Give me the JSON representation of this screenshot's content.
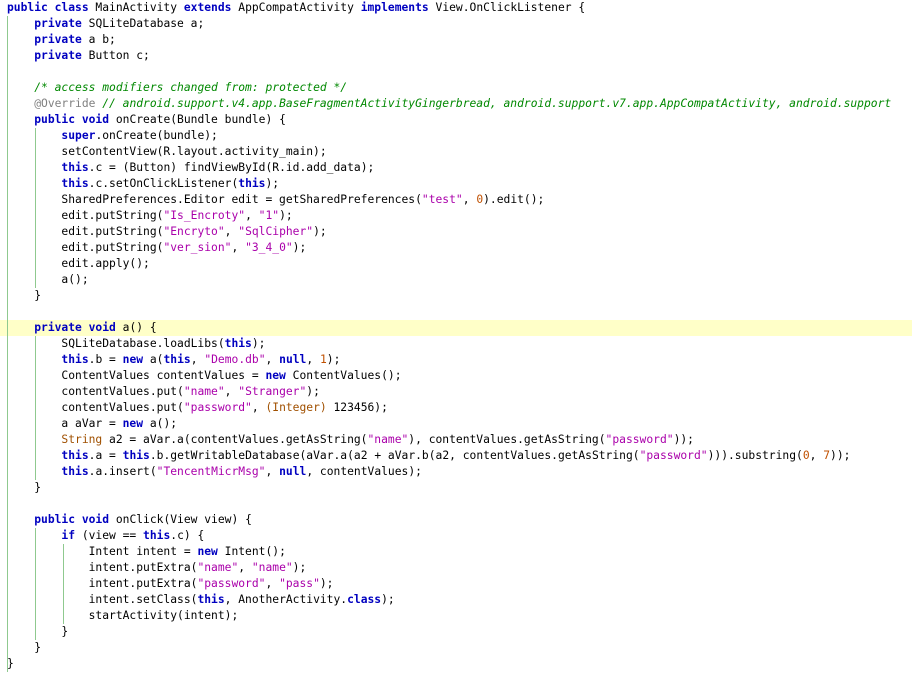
{
  "code_lines": [
    [
      [
        "kw",
        "public class "
      ],
      [
        "p",
        "MainActivity "
      ],
      [
        "kw",
        "extends "
      ],
      [
        "p",
        "AppCompatActivity "
      ],
      [
        "kw",
        "implements "
      ],
      [
        "p",
        "View.OnClickListener {"
      ]
    ],
    [
      [
        "p",
        "    "
      ],
      [
        "kw",
        "private "
      ],
      [
        "p",
        "SQLiteDatabase a;"
      ]
    ],
    [
      [
        "p",
        "    "
      ],
      [
        "kw",
        "private "
      ],
      [
        "p",
        "a b;"
      ]
    ],
    [
      [
        "p",
        "    "
      ],
      [
        "kw",
        "private "
      ],
      [
        "p",
        "Button c;"
      ]
    ],
    [],
    [
      [
        "p",
        "    "
      ],
      [
        "cm",
        "/* access modifiers changed from: protected */"
      ]
    ],
    [
      [
        "p",
        "    "
      ],
      [
        "an",
        "@Override "
      ],
      [
        "cm",
        "// android.support.v4.app.BaseFragmentActivityGingerbread, android.support.v7.app.AppCompatActivity, android.support"
      ]
    ],
    [
      [
        "p",
        "    "
      ],
      [
        "kw",
        "public void "
      ],
      [
        "p",
        "onCreate(Bundle bundle) {"
      ]
    ],
    [
      [
        "p",
        "        "
      ],
      [
        "kw",
        "super"
      ],
      [
        "p",
        ".onCreate(bundle);"
      ]
    ],
    [
      [
        "p",
        "        setContentView(R.layout.activity_main);"
      ]
    ],
    [
      [
        "p",
        "        "
      ],
      [
        "kw",
        "this"
      ],
      [
        "p",
        ".c = (Button) findViewById(R.id.add_data);"
      ]
    ],
    [
      [
        "p",
        "        "
      ],
      [
        "kw",
        "this"
      ],
      [
        "p",
        ".c.setOnClickListener("
      ],
      [
        "kw",
        "this"
      ],
      [
        "p",
        ");"
      ]
    ],
    [
      [
        "p",
        "        SharedPreferences.Editor edit = getSharedPreferences("
      ],
      [
        "str",
        "\"test\""
      ],
      [
        "p",
        ", "
      ],
      [
        "num",
        "0"
      ],
      [
        "p",
        ").edit();"
      ]
    ],
    [
      [
        "p",
        "        edit.putString("
      ],
      [
        "str",
        "\"Is_Encroty\""
      ],
      [
        "p",
        ", "
      ],
      [
        "str",
        "\"1\""
      ],
      [
        "p",
        ");"
      ]
    ],
    [
      [
        "p",
        "        edit.putString("
      ],
      [
        "str",
        "\"Encryto\""
      ],
      [
        "p",
        ", "
      ],
      [
        "str",
        "\"SqlCipher\""
      ],
      [
        "p",
        ");"
      ]
    ],
    [
      [
        "p",
        "        edit.putString("
      ],
      [
        "str",
        "\"ver_sion\""
      ],
      [
        "p",
        ", "
      ],
      [
        "str",
        "\"3_4_0\""
      ],
      [
        "p",
        ");"
      ]
    ],
    [
      [
        "p",
        "        edit.apply();"
      ]
    ],
    [
      [
        "p",
        "        a();"
      ]
    ],
    [
      [
        "p",
        "    }"
      ]
    ],
    [],
    [
      [
        "p",
        "    "
      ],
      [
        "kw",
        "private void "
      ],
      [
        "p",
        "a() {"
      ]
    ],
    [
      [
        "p",
        "        SQLiteDatabase.loadLibs("
      ],
      [
        "kw",
        "this"
      ],
      [
        "p",
        ");"
      ]
    ],
    [
      [
        "p",
        "        "
      ],
      [
        "kw",
        "this"
      ],
      [
        "p",
        ".b = "
      ],
      [
        "kw",
        "new "
      ],
      [
        "p",
        "a("
      ],
      [
        "kw",
        "this"
      ],
      [
        "p",
        ", "
      ],
      [
        "str",
        "\"Demo.db\""
      ],
      [
        "p",
        ", "
      ],
      [
        "kw",
        "null"
      ],
      [
        "p",
        ", "
      ],
      [
        "num",
        "1"
      ],
      [
        "p",
        ");"
      ]
    ],
    [
      [
        "p",
        "        ContentValues contentValues = "
      ],
      [
        "kw",
        "new "
      ],
      [
        "p",
        "ContentValues();"
      ]
    ],
    [
      [
        "p",
        "        contentValues.put("
      ],
      [
        "str",
        "\"name\""
      ],
      [
        "p",
        ", "
      ],
      [
        "str",
        "\"Stranger\""
      ],
      [
        "p",
        ");"
      ]
    ],
    [
      [
        "p",
        "        contentValues.put("
      ],
      [
        "str",
        "\"password\""
      ],
      [
        "p",
        ", "
      ],
      [
        "ty",
        "(Integer) "
      ],
      [
        "p",
        "123456);"
      ]
    ],
    [
      [
        "p",
        "        a aVar = "
      ],
      [
        "kw",
        "new "
      ],
      [
        "p",
        "a();"
      ]
    ],
    [
      [
        "p",
        "        "
      ],
      [
        "ty",
        "String "
      ],
      [
        "p",
        "a2 = aVar.a(contentValues.getAsString("
      ],
      [
        "str",
        "\"name\""
      ],
      [
        "p",
        "), contentValues.getAsString("
      ],
      [
        "str",
        "\"password\""
      ],
      [
        "p",
        "));"
      ]
    ],
    [
      [
        "p",
        "        "
      ],
      [
        "kw",
        "this"
      ],
      [
        "p",
        ".a = "
      ],
      [
        "kw",
        "this"
      ],
      [
        "p",
        ".b.getWritableDatabase(aVar.a(a2 + aVar.b(a2, contentValues.getAsString("
      ],
      [
        "str",
        "\"password\""
      ],
      [
        "p",
        "))).substring("
      ],
      [
        "num",
        "0"
      ],
      [
        "p",
        ", "
      ],
      [
        "num",
        "7"
      ],
      [
        "p",
        "));"
      ]
    ],
    [
      [
        "p",
        "        "
      ],
      [
        "kw",
        "this"
      ],
      [
        "p",
        ".a.insert("
      ],
      [
        "str",
        "\"TencentMicrMsg\""
      ],
      [
        "p",
        ", "
      ],
      [
        "kw",
        "null"
      ],
      [
        "p",
        ", contentValues);"
      ]
    ],
    [
      [
        "p",
        "    }"
      ]
    ],
    [],
    [
      [
        "p",
        "    "
      ],
      [
        "kw",
        "public void "
      ],
      [
        "p",
        "onClick(View view) {"
      ]
    ],
    [
      [
        "p",
        "        "
      ],
      [
        "kw",
        "if "
      ],
      [
        "p",
        "(view == "
      ],
      [
        "kw",
        "this"
      ],
      [
        "p",
        ".c) {"
      ]
    ],
    [
      [
        "p",
        "            Intent intent = "
      ],
      [
        "kw",
        "new "
      ],
      [
        "p",
        "Intent();"
      ]
    ],
    [
      [
        "p",
        "            intent.putExtra("
      ],
      [
        "str",
        "\"name\""
      ],
      [
        "p",
        ", "
      ],
      [
        "str",
        "\"name\""
      ],
      [
        "p",
        ");"
      ]
    ],
    [
      [
        "p",
        "            intent.putExtra("
      ],
      [
        "str",
        "\"password\""
      ],
      [
        "p",
        ", "
      ],
      [
        "str",
        "\"pass\""
      ],
      [
        "p",
        ");"
      ]
    ],
    [
      [
        "p",
        "            intent.setClass("
      ],
      [
        "kw",
        "this"
      ],
      [
        "p",
        ", AnotherActivity."
      ],
      [
        "kw",
        "class"
      ],
      [
        "p",
        ");"
      ]
    ],
    [
      [
        "p",
        "            startActivity(intent);"
      ]
    ],
    [
      [
        "p",
        "        }"
      ]
    ],
    [
      [
        "p",
        "    }"
      ]
    ],
    [
      [
        "p",
        "}"
      ]
    ]
  ],
  "highlighted_line": 20
}
